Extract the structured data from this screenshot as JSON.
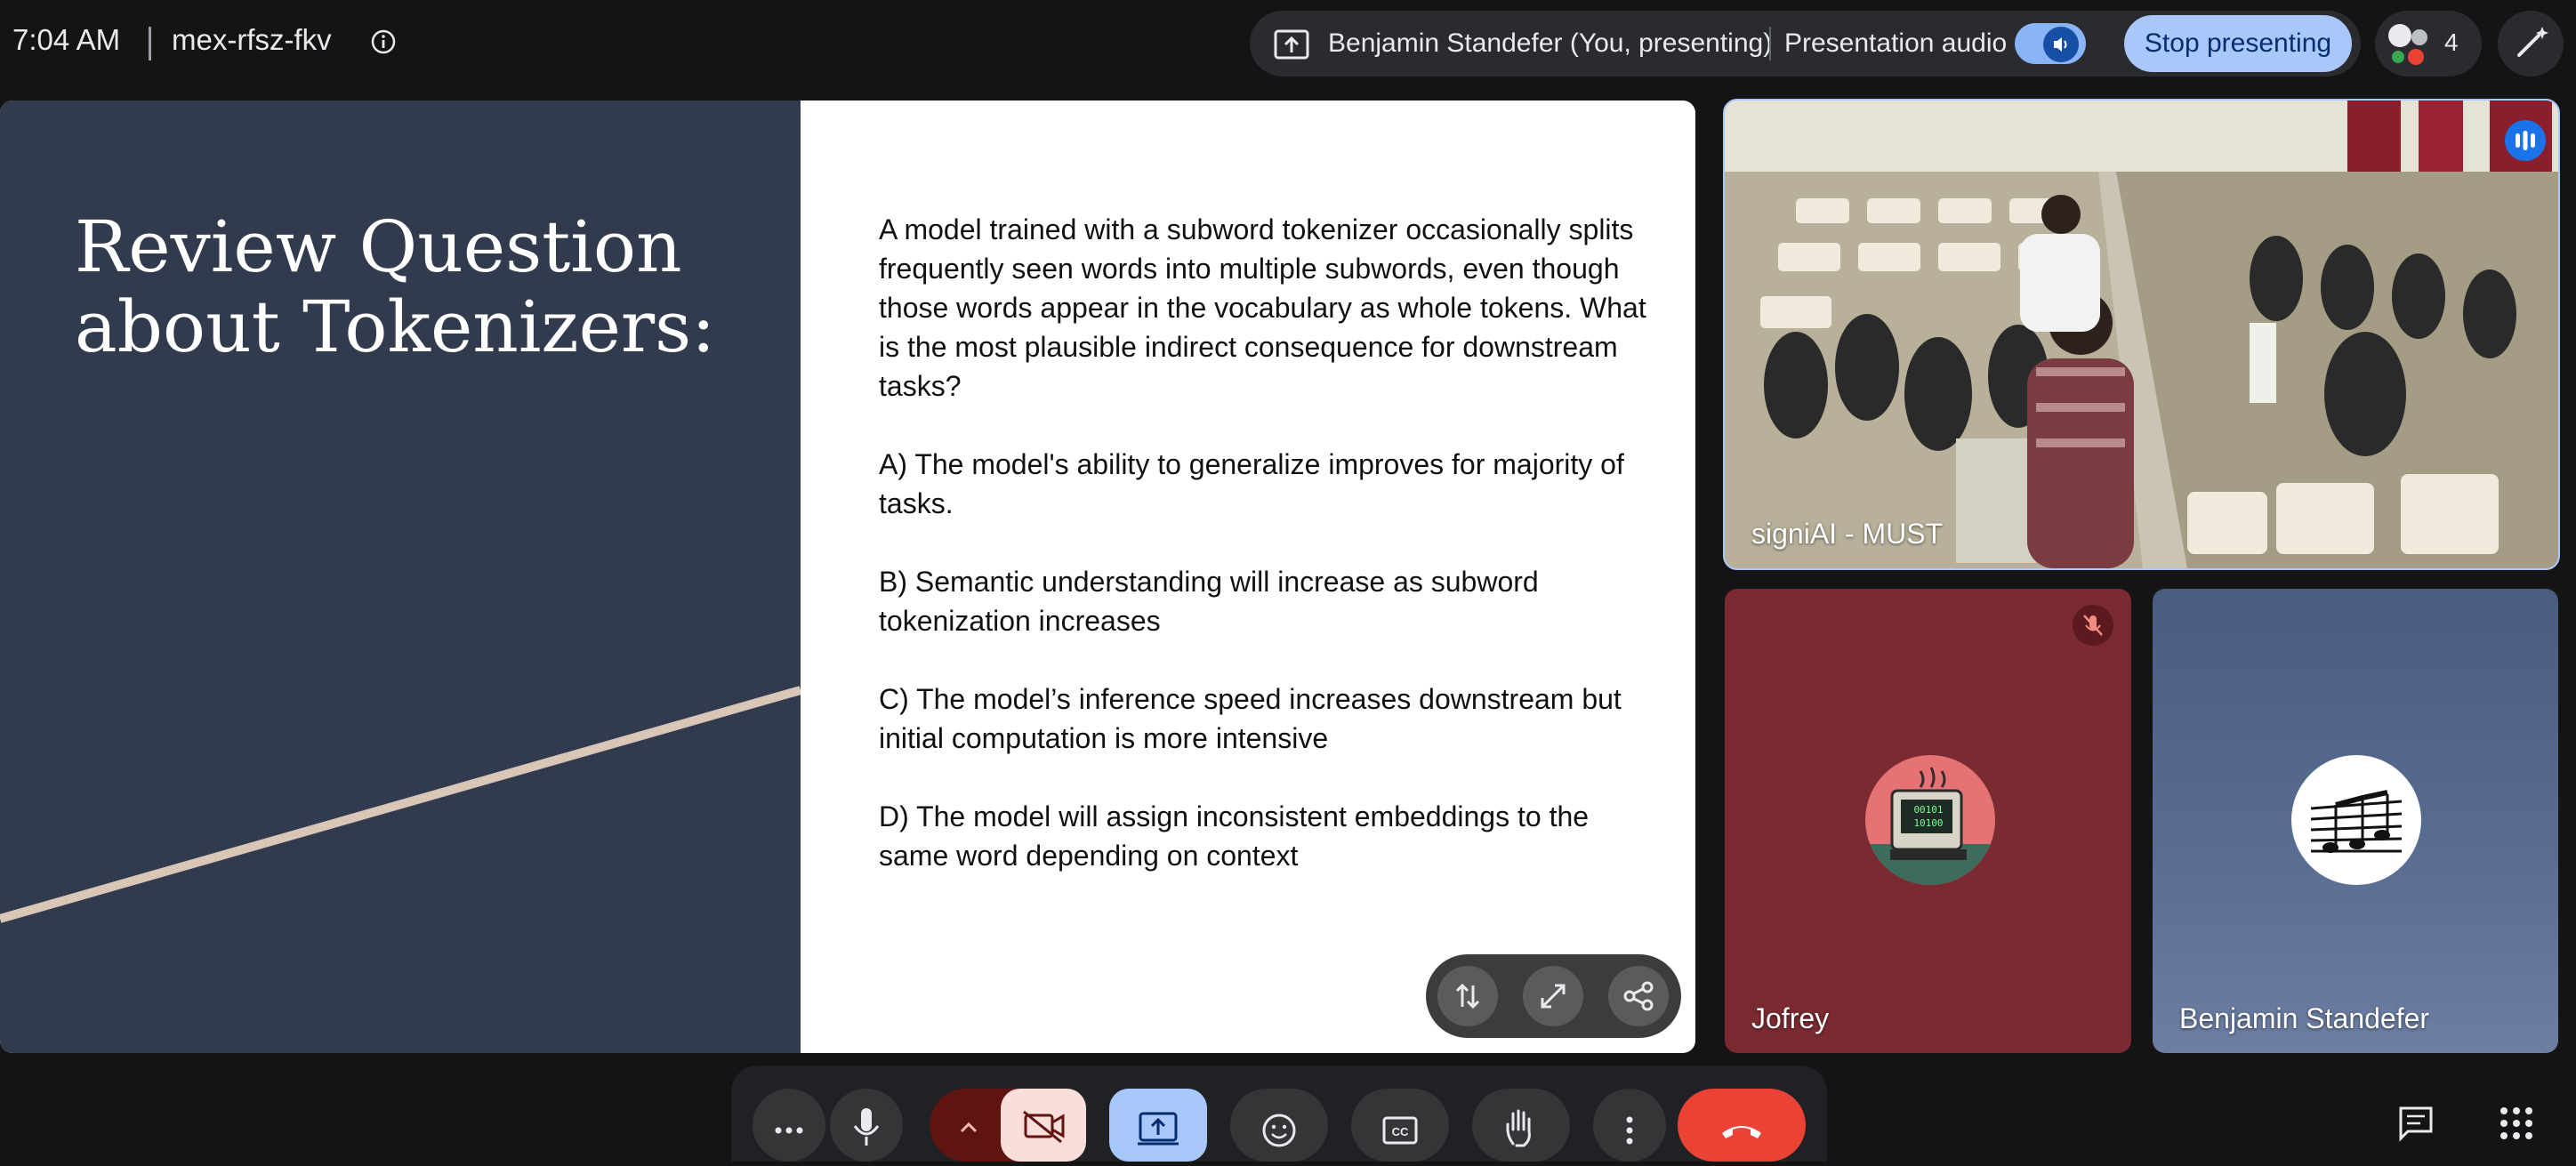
{
  "topbar": {
    "time": "7:04 AM",
    "meeting_code": "mex-rfsz-fkv",
    "presenter_text": "Benjamin Standefer (You, presenting)",
    "audio_label": "Presentation audio",
    "stop_label": "Stop presenting",
    "people_count": "4"
  },
  "slide": {
    "title": "Review Question\nabout Tokenizers:",
    "paragraphs": [
      "A model trained with a subword tokenizer occasionally splits frequently seen words into multiple subwords, even though those words appear in the vocabulary as whole tokens. What is the most plausible indirect consequence for downstream tasks?",
      "A) The model's ability to generalize improves for majority of tasks.",
      "B) Semantic understanding will increase as subword tokenization increases",
      "C) The model’s inference speed increases downstream but initial computation is more intensive",
      "D) The model will assign inconsistent embeddings to the same word depending on context"
    ]
  },
  "tiles": {
    "main_name": "signiAI - MUST",
    "jofrey_name": "Jofrey",
    "jofrey_avatar_text": "00101\n10100",
    "benjamin_name": "Benjamin Standefer"
  },
  "colors": {
    "accent": "#a8c7fa",
    "end_call": "#ea4335",
    "camera_off_bg": "#f9dedc",
    "camera_off_group": "#601410",
    "slide_left": "#323a4e"
  }
}
